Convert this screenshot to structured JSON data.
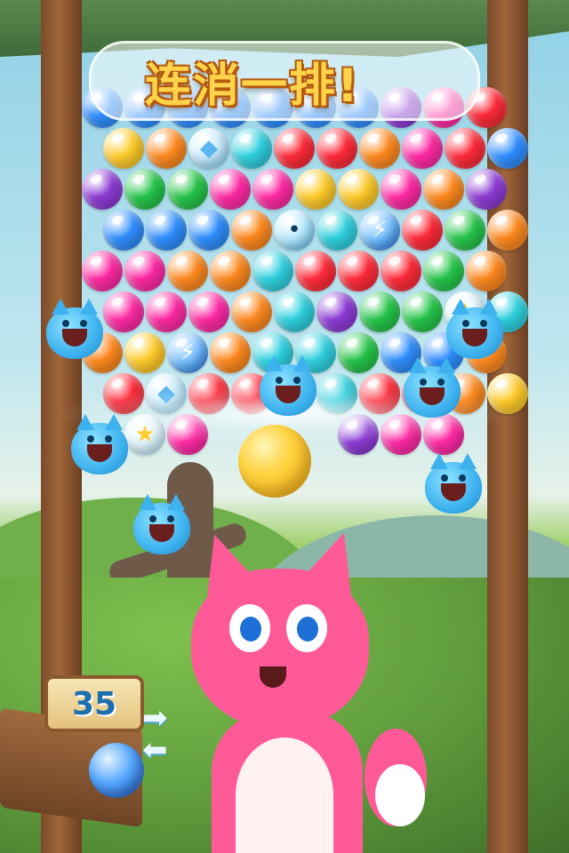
{
  "banner": {
    "text": "连消一排!"
  },
  "shots_left": {
    "value": "35"
  },
  "colors": {
    "red": "#ff2b3a",
    "orange": "#ff8a1f",
    "yellow": "#ffcc2a",
    "green": "#25c64a",
    "cyan": "#2fd2e0",
    "blue": "#2f8fff",
    "purple": "#8d3bd6",
    "pink": "#ff2aa5",
    "light": "#e9f8ff"
  },
  "grid": {
    "rows": [
      [
        "blue",
        "blue",
        "blue",
        "blue",
        "blue",
        "blue",
        "blue",
        "purple",
        "pink",
        "red"
      ],
      [
        "yellow",
        "orange",
        "diamond",
        "cyan",
        "red",
        "red",
        "orange",
        "pink",
        "red",
        "blue"
      ],
      [
        "purple",
        "green",
        "green",
        "pink",
        "pink",
        "yellow",
        "yellow",
        "pink",
        "orange",
        "purple"
      ],
      [
        "blue",
        "blue",
        "blue",
        "orange",
        "bird",
        "cyan",
        "lightning",
        "red",
        "green",
        "orange"
      ],
      [
        "pink",
        "pink",
        "orange",
        "orange",
        "cyan",
        "red",
        "red",
        "red",
        "green",
        "orange"
      ],
      [
        "pink",
        "pink",
        "pink",
        "orange",
        "cyan",
        "purple",
        "green",
        "green",
        "star",
        "cyan"
      ],
      [
        "orange",
        "yellow",
        "lightning",
        "orange",
        "cyan",
        "cyan",
        "green",
        "blue",
        "blue",
        "orange"
      ],
      [
        "red",
        "diamond",
        "red",
        "red",
        "cyan",
        "cyan",
        "red",
        "red",
        "orange",
        "yellow"
      ],
      [
        "empty",
        "star",
        "pink",
        "empty",
        "empty",
        "empty",
        "purple",
        "pink",
        "pink",
        "empty"
      ]
    ]
  },
  "shooter": {
    "ball_color": "yellow"
  },
  "next_ball": {
    "color": "blue"
  }
}
